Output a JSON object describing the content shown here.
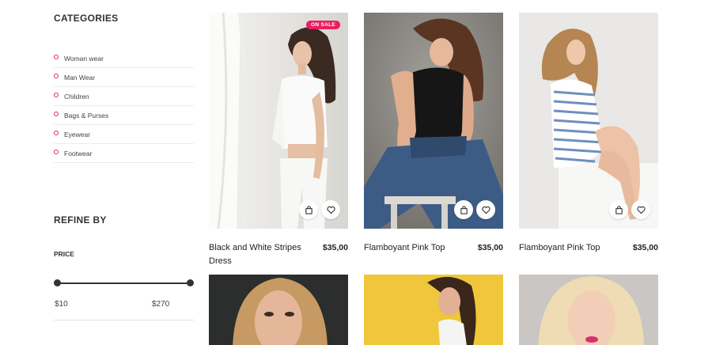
{
  "sidebar": {
    "categories_title": "CATEGORIES",
    "categories": [
      {
        "label": "Woman wear"
      },
      {
        "label": "Man Wear"
      },
      {
        "label": "Children"
      },
      {
        "label": "Bags & Purses"
      },
      {
        "label": "Eyewear"
      },
      {
        "label": "Footwear"
      }
    ],
    "refine_title": "REFINE BY",
    "price_title": "PRICE",
    "price_min": "$10",
    "price_max": "$270"
  },
  "products": [
    {
      "name": "Black and White Stripes Dress",
      "price": "$35,00",
      "badge": "ON SALE"
    },
    {
      "name": "Flamboyant Pink Top",
      "price": "$35,00"
    },
    {
      "name": "Flamboyant Pink Top",
      "price": "$35,00"
    }
  ],
  "colors": {
    "accent": "#e91e63",
    "category_dot": "#e2245f",
    "text": "#222222"
  },
  "icons": {
    "add_to_cart": "shopping-bag-icon",
    "wishlist": "heart-icon"
  }
}
